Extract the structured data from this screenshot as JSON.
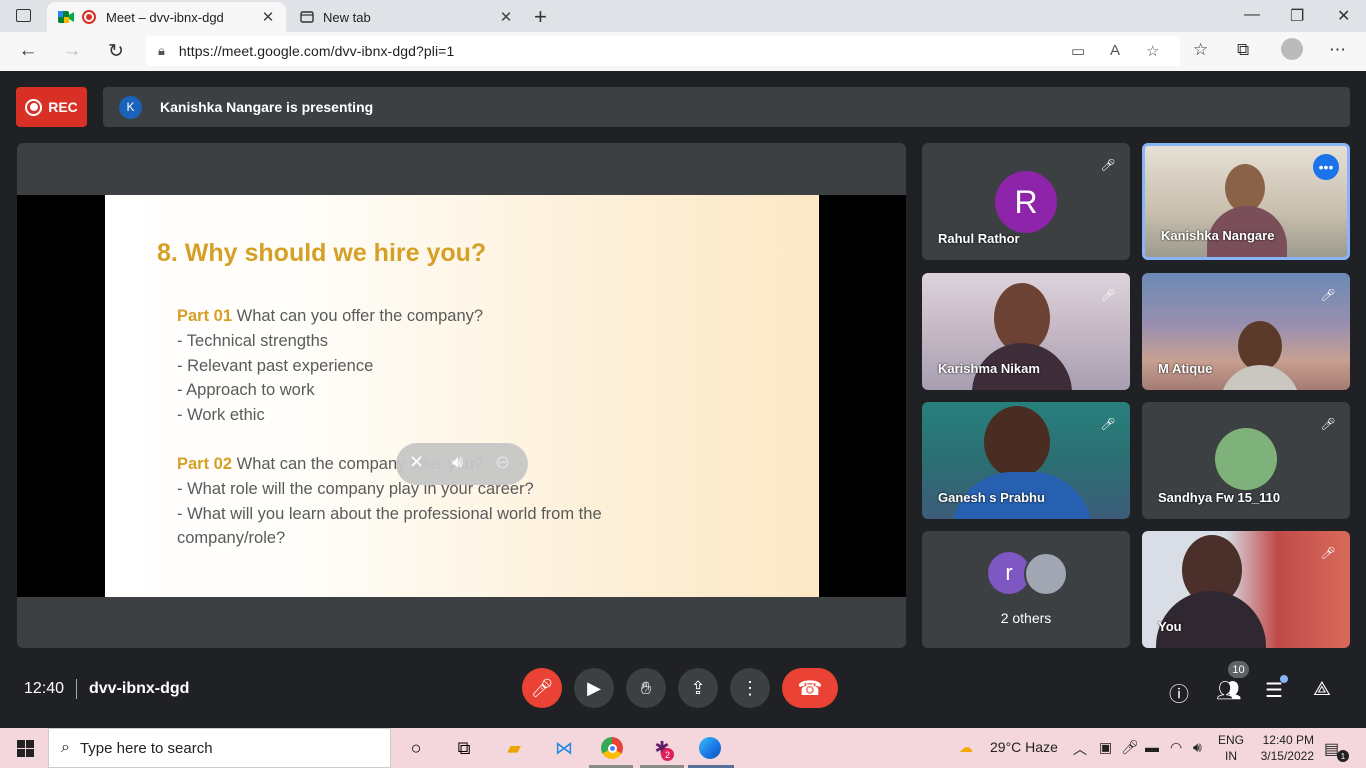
{
  "browser": {
    "tabs": [
      {
        "title": "Meet – dvv-ibnx-dgd",
        "active": true
      },
      {
        "title": "New tab",
        "active": false
      }
    ],
    "url": "https://meet.google.com/dvv-ibnx-dgd?pli=1"
  },
  "meet": {
    "rec_label": "REC",
    "presenter_initial": "K",
    "presenting_text": "Kanishka Nangare is presenting",
    "slide": {
      "title": "8. Why should we hire you?",
      "part1_label": "Part 01",
      "part1_question": " What can you offer the company?",
      "part1_items": [
        "- Technical strengths",
        "- Relevant past experience",
        "- Approach to work",
        "- Work ethic"
      ],
      "part2_label": "Part 02",
      "part2_question": " What can the company offer you?",
      "part2_items": [
        "- What role will the company play in your career?",
        "- What will you learn about the professional world from the",
        "company/role?"
      ]
    },
    "participants": [
      {
        "name": "Rahul Rathor",
        "initial": "R",
        "avatar_color": "#8e24aa"
      },
      {
        "name": "Kanishka Nangare"
      },
      {
        "name": "Karishma Nikam"
      },
      {
        "name": "M Atique"
      },
      {
        "name": "Ganesh s Prabhu"
      },
      {
        "name": "Sandhya Fw 15_110"
      },
      {
        "name": "2 others",
        "initial": "r"
      },
      {
        "name": "You"
      }
    ],
    "time": "12:40",
    "meeting_code": "dvv-ibnx-dgd",
    "participant_count": "10"
  },
  "taskbar": {
    "search_placeholder": "Type here to search",
    "weather": "29°C  Haze",
    "lang1": "ENG",
    "lang2": "IN",
    "time": "12:40 PM",
    "date": "3/15/2022",
    "notif_count": "1",
    "slack_badge": "2"
  }
}
